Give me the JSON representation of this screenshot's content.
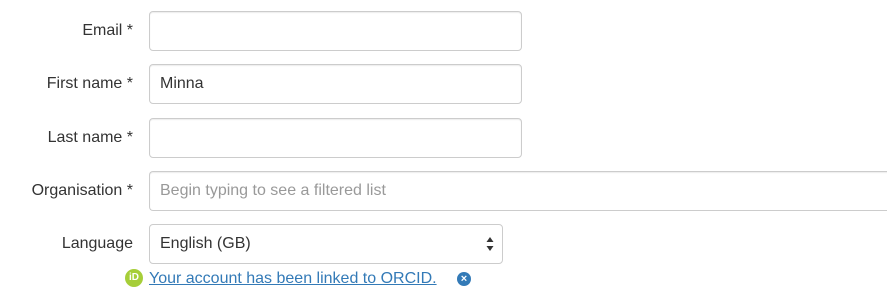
{
  "form": {
    "email": {
      "label": "Email *",
      "value": "",
      "placeholder": ""
    },
    "first_name": {
      "label": "First name *",
      "value": "Minna",
      "placeholder": ""
    },
    "last_name": {
      "label": "Last name *",
      "value": "",
      "placeholder": ""
    },
    "organisation": {
      "label": "Organisation *",
      "value": "",
      "placeholder": "Begin typing to see a filtered list"
    },
    "language": {
      "label": "Language",
      "selected": "English (GB)"
    }
  },
  "orcid": {
    "icon_text": "iD",
    "message": "Your account has been linked to ORCID.",
    "unlink_icon": "×"
  },
  "colors": {
    "link": "#337ab7",
    "orcid_green": "#a6ce39"
  }
}
